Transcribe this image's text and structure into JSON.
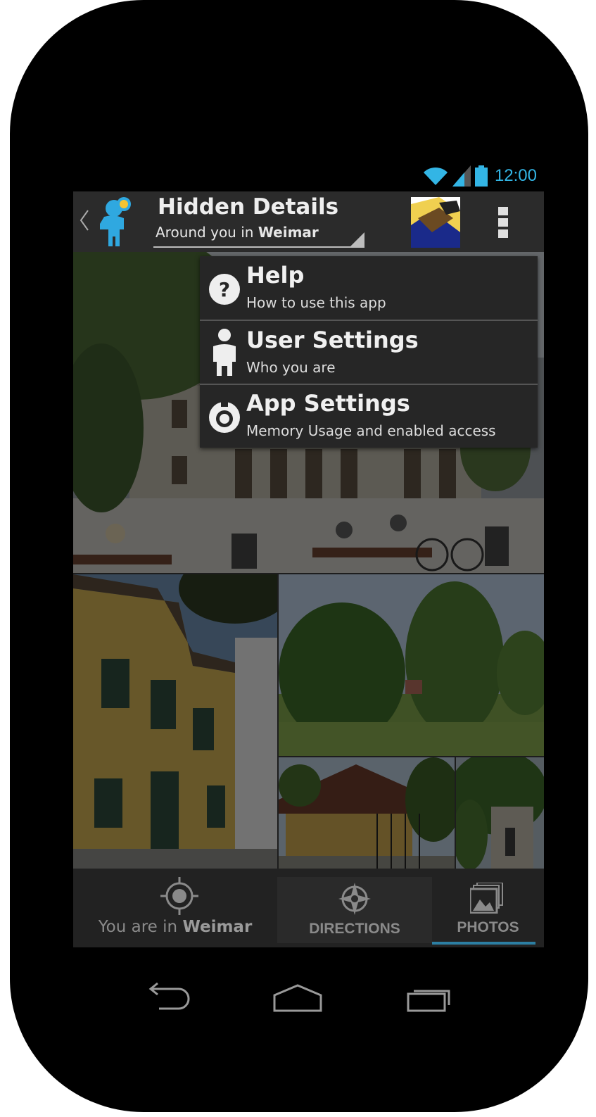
{
  "status_bar": {
    "time": "12:00",
    "accent_color": "#33b5e5"
  },
  "action_bar": {
    "title": "Hidden Details",
    "subtitle_prefix": "Around you in",
    "subtitle_city": "Weimar",
    "logo_icon": "person-pin-icon",
    "overflow_icon": "overflow-menu-icon"
  },
  "menu": {
    "items": [
      {
        "title": "Help",
        "subtitle": "How to use this app",
        "icon": "help-icon"
      },
      {
        "title": "User Settings",
        "subtitle": "Who you are",
        "icon": "user-icon"
      },
      {
        "title": "App Settings",
        "subtitle": "Memory Usage and enabled access",
        "icon": "gear-icon"
      }
    ]
  },
  "tabs": {
    "location_prefix": "You are in",
    "location_city": "Weimar",
    "directions": "DIRECTIONS",
    "photos": "PHOTOS",
    "selected": "PHOTOS",
    "indicator_color": "#2c7fa3"
  },
  "nav": {
    "back_icon": "back-icon",
    "home_icon": "home-icon",
    "recents_icon": "recents-icon"
  }
}
